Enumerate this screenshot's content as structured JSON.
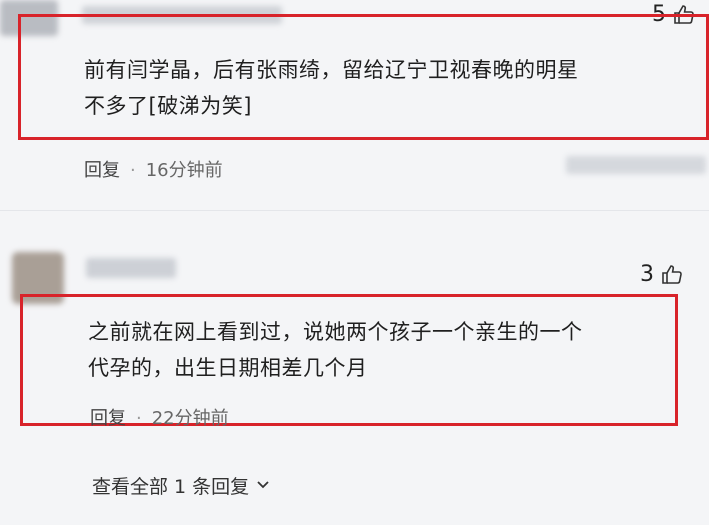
{
  "comments": [
    {
      "text_line1": "前有闫学晶，后有张雨绮，留给辽宁卫视春晚的明星",
      "text_line2": "不多了[破涕为笑]",
      "reply_label": "回复",
      "dot": "·",
      "time": "16分钟前",
      "likes": "5"
    },
    {
      "text_line1": "之前就在网上看到过，说她两个孩子一个亲生的一个",
      "text_line2": "代孕的，出生日期相差几个月",
      "reply_label": "回复",
      "dot": "·",
      "time": "22分钟前",
      "likes": "3"
    }
  ],
  "view_replies": "查看全部 1 条回复",
  "colors": {
    "highlight_box": "#d8232a",
    "background": "#f4f5f7"
  },
  "icons": [
    "avatar",
    "thumbs-up-icon",
    "chevron-down-icon"
  ]
}
